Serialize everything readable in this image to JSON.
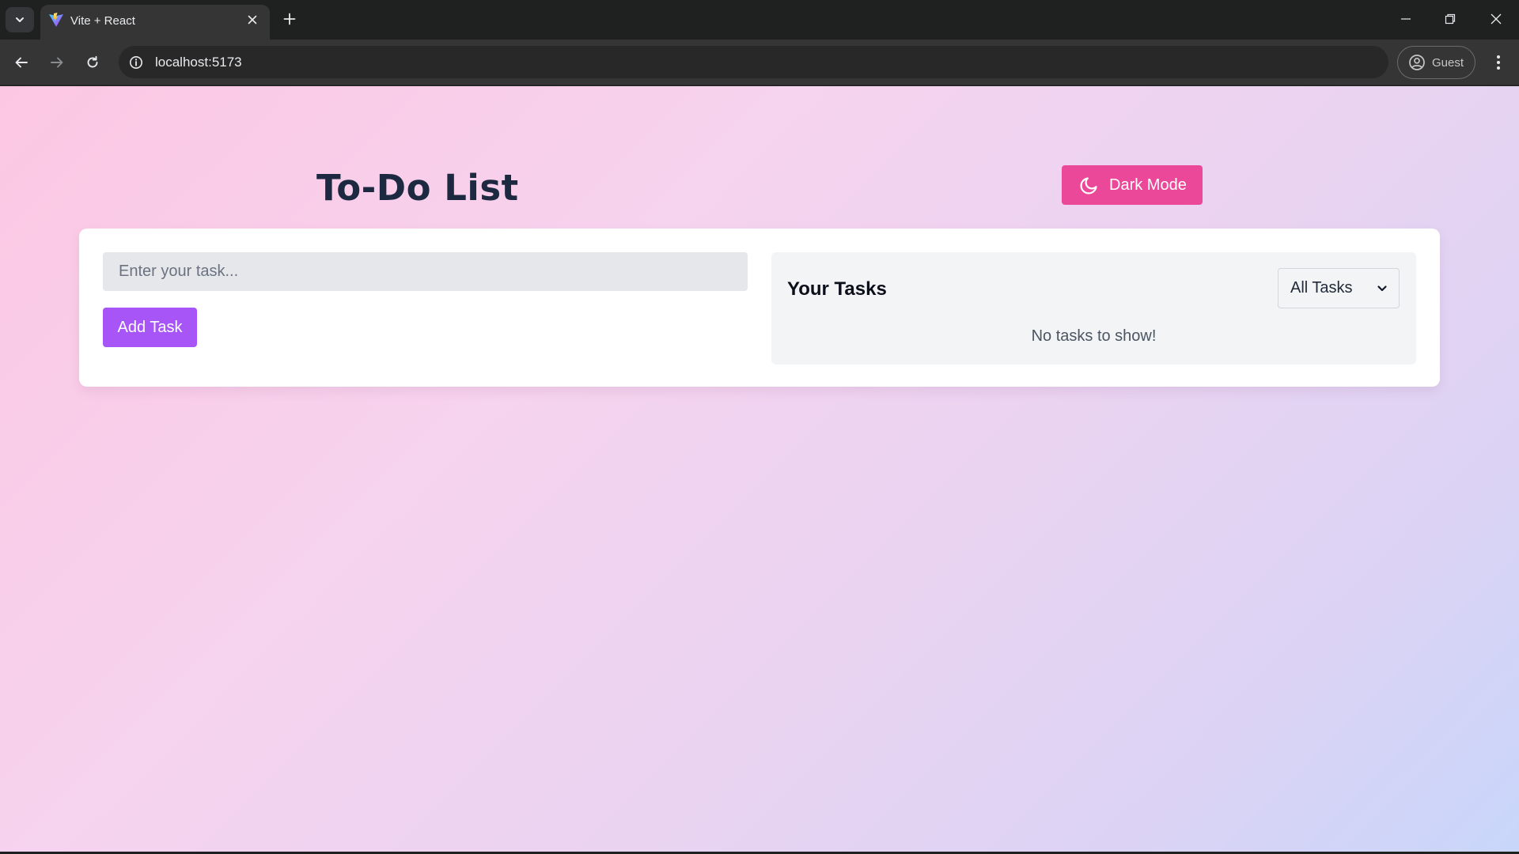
{
  "browser": {
    "tab": {
      "title": "Vite + React"
    },
    "address_bar": {
      "url": "localhost:5173"
    },
    "profile": {
      "label": "Guest"
    }
  },
  "app": {
    "title": "To-Do List",
    "theme_toggle": {
      "label": "Dark Mode",
      "icon": "moon-icon"
    },
    "task_input": {
      "placeholder": "Enter your task...",
      "value": ""
    },
    "add_button": {
      "label": "Add Task"
    },
    "tasks_panel": {
      "heading": "Your Tasks",
      "filter": {
        "selected": "All Tasks"
      },
      "empty_message": "No tasks to show!",
      "tasks": []
    }
  },
  "colors": {
    "dark_mode_button": "#ec4899",
    "add_task_button": "#a855f7",
    "title_text": "#1d2940",
    "background_gradient": [
      "#fcc7e3",
      "#ead3f1",
      "#c8d6fa"
    ]
  }
}
